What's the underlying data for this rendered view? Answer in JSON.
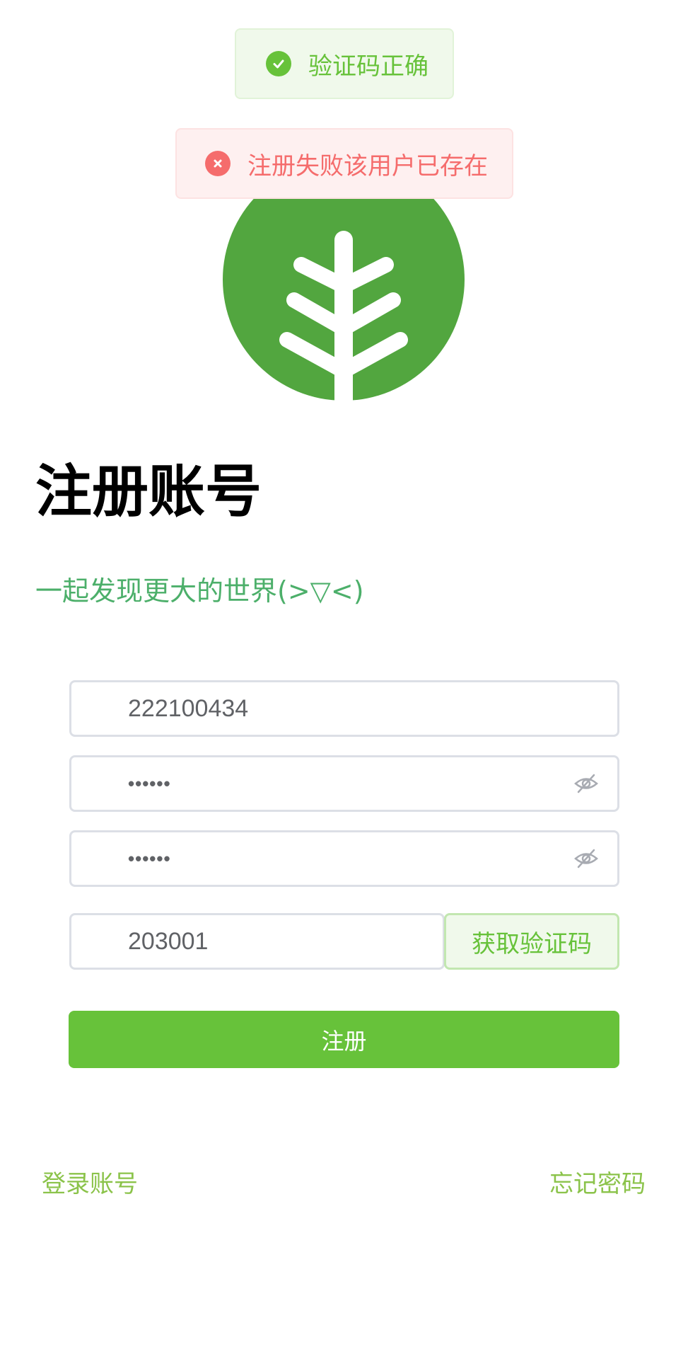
{
  "toasts": {
    "success": {
      "icon": "check-circle-icon",
      "message": "验证码正确"
    },
    "error": {
      "icon": "close-circle-icon",
      "message": "注册失败该用户已存在"
    }
  },
  "logo": {
    "icon": "tree-logo-icon",
    "color": "#52a63f"
  },
  "page": {
    "title": "注册账号",
    "subtitle": "一起发现更大的世界(>▽<)"
  },
  "form": {
    "username": {
      "value": "222100434"
    },
    "password": {
      "value": "123456",
      "icon": "eye-off-icon"
    },
    "confirm_password": {
      "value": "123456",
      "icon": "eye-off-icon"
    },
    "code": {
      "value": "203001"
    },
    "get_code_label": "获取验证码",
    "submit_label": "注册"
  },
  "links": {
    "login": "登录账号",
    "forgot": "忘记密码"
  },
  "colors": {
    "primary": "#67c23a",
    "success_bg": "#f0f9eb",
    "error": "#f56c6c",
    "error_bg": "#fef0f0",
    "link": "#8bc34a",
    "subtitle": "#4caf6a"
  }
}
